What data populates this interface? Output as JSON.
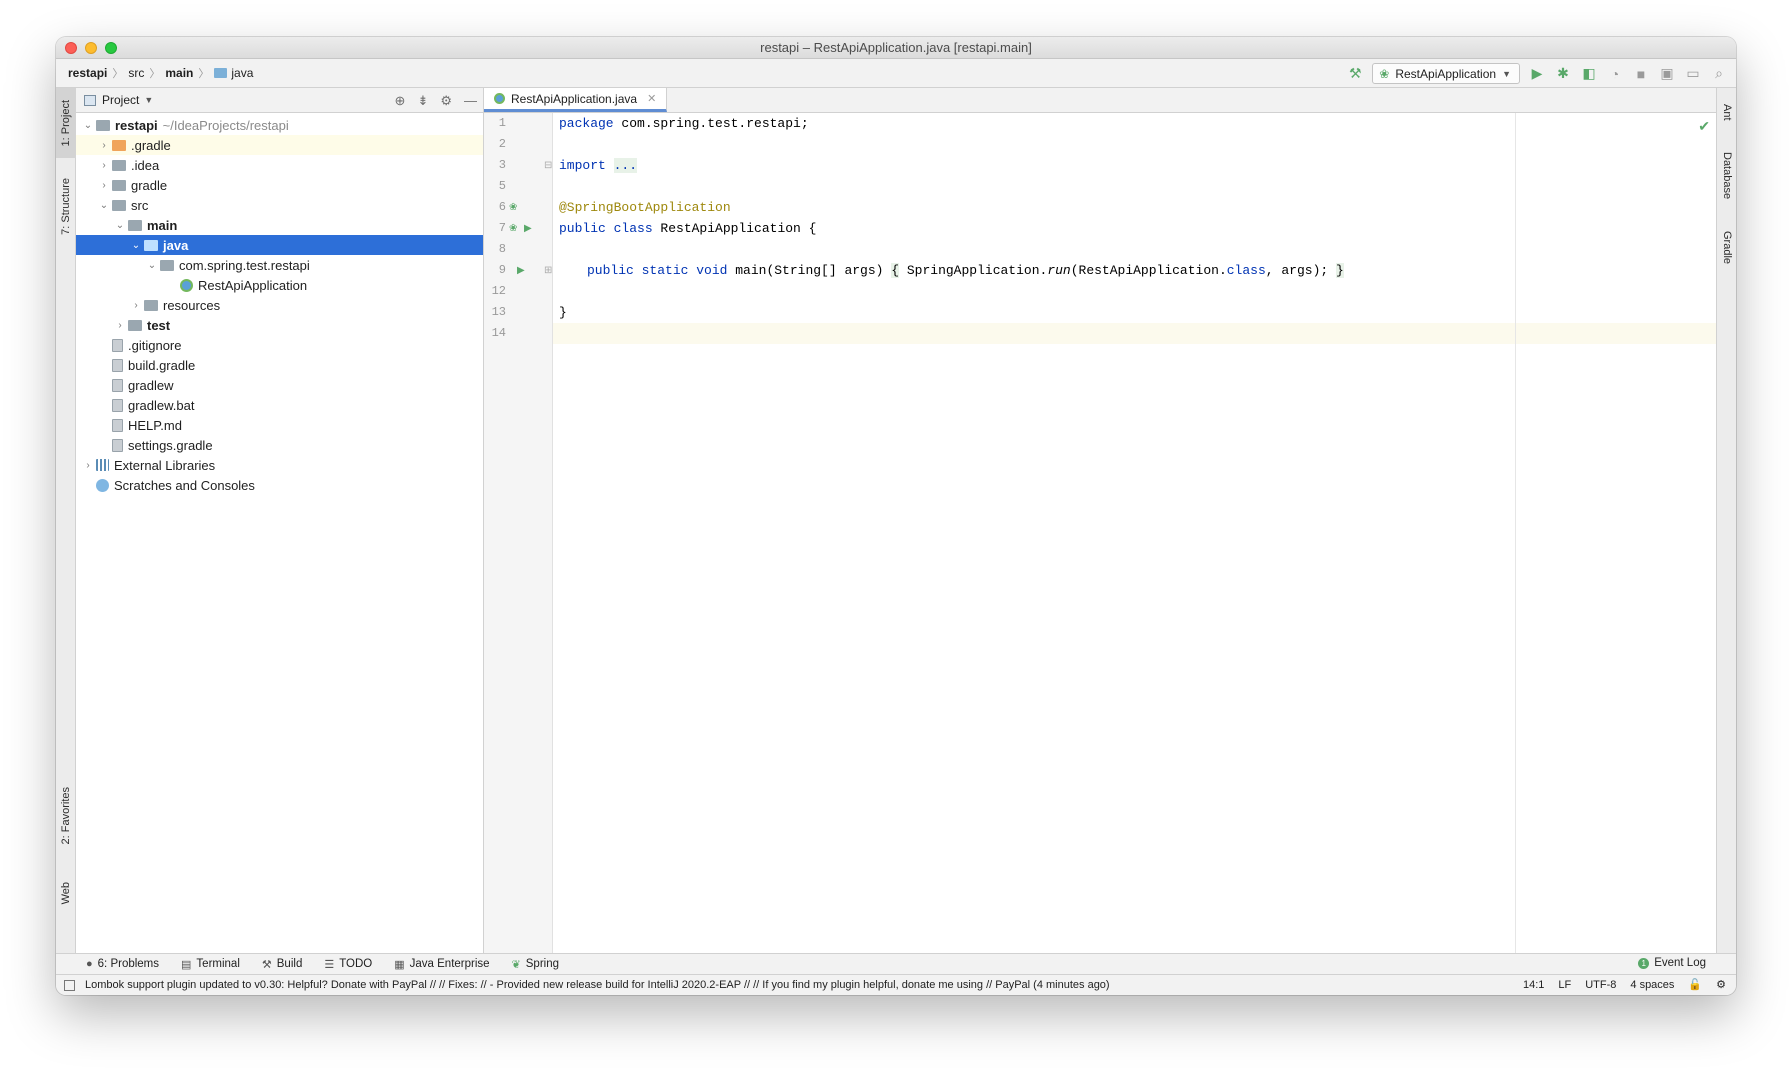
{
  "window": {
    "title": "restapi – RestApiApplication.java [restapi.main]"
  },
  "breadcrumbs": [
    "restapi",
    "src",
    "main",
    "java"
  ],
  "toolbar": {
    "run_config": "RestApiApplication"
  },
  "left_stripe": {
    "project": "1: Project",
    "structure": "7: Structure",
    "favorites": "2: Favorites",
    "web": "Web"
  },
  "right_stripe": {
    "ant": "Ant",
    "database": "Database",
    "gradle": "Gradle"
  },
  "project_panel": {
    "title": "Project",
    "tree": [
      {
        "label": "restapi",
        "extra": "~/IdeaProjects/restapi"
      },
      {
        "label": ".gradle"
      },
      {
        "label": ".idea"
      },
      {
        "label": "gradle"
      },
      {
        "label": "src"
      },
      {
        "label": "main"
      },
      {
        "label": "java"
      },
      {
        "label": "com.spring.test.restapi"
      },
      {
        "label": "RestApiApplication"
      },
      {
        "label": "resources"
      },
      {
        "label": "test"
      },
      {
        "label": ".gitignore"
      },
      {
        "label": "build.gradle"
      },
      {
        "label": "gradlew"
      },
      {
        "label": "gradlew.bat"
      },
      {
        "label": "HELP.md"
      },
      {
        "label": "settings.gradle"
      },
      {
        "label": "External Libraries"
      },
      {
        "label": "Scratches and Consoles"
      }
    ]
  },
  "editor": {
    "tab": "RestApiApplication.java",
    "line_numbers": [
      "1",
      "2",
      "3",
      "5",
      "6",
      "7",
      "8",
      "9",
      "12",
      "13",
      "14"
    ],
    "code": {
      "l1_kw": "package",
      "l1_rest": " com.spring.test.restapi;",
      "l3_kw": "import",
      "l3_fold": "...",
      "l6": "@SpringBootApplication",
      "l7_kw": "public class",
      "l7_rest": " RestApiApplication {",
      "l9_kw": "public static void",
      "l9_a": " main(String[] args) ",
      "l9_ob": "{",
      "l9_b": " SpringApplication.",
      "l9_run": "run",
      "l9_c": "(RestApiApplication.",
      "l9_class": "class",
      "l9_d": ", args); ",
      "l9_cb": "}",
      "l13": "}"
    }
  },
  "bottom_tools": {
    "problems": "6: Problems",
    "terminal": "Terminal",
    "build": "Build",
    "todo": "TODO",
    "java_enterprise": "Java Enterprise",
    "spring": "Spring",
    "event_log": "Event Log"
  },
  "status": {
    "message": "Lombok support plugin updated to v0.30: Helpful? Donate with PayPal // // Fixes: // - Provided new release build for IntelliJ 2020.2-EAP // // If you find my plugin helpful, donate me using // PayPal (4 minutes ago)",
    "position": "14:1",
    "line_sep": "LF",
    "encoding": "UTF-8",
    "indent": "4 spaces"
  }
}
